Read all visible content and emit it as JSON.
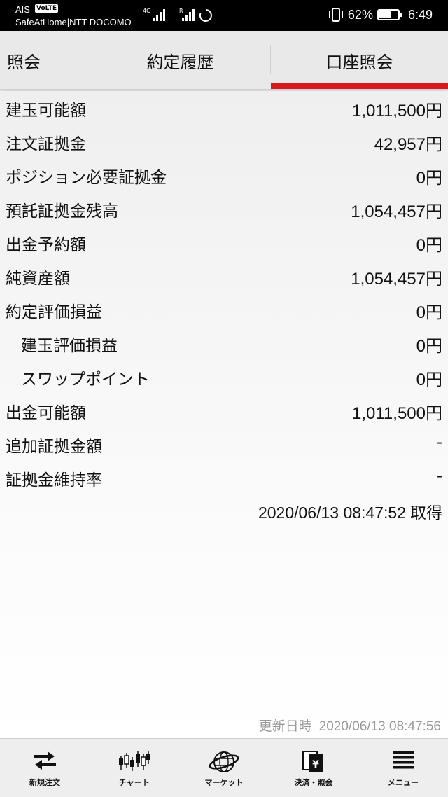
{
  "status_bar": {
    "carrier1": "AIS",
    "volte": "VoLTE",
    "carrier2": "SafeAtHome|NTT DOCOMO",
    "battery_percent": "62%",
    "battery_level": 0.62,
    "time": "6:49"
  },
  "tabs": [
    {
      "label": "照会"
    },
    {
      "label": "約定履歴"
    },
    {
      "label": "口座照会",
      "active": true
    }
  ],
  "accent_color": "#d9191e",
  "rows": [
    {
      "label": "建玉可能額",
      "value": "1,011,500円"
    },
    {
      "label": "注文証拠金",
      "value": "42,957円"
    },
    {
      "label": "ポジション必要証拠金",
      "value": "0円"
    },
    {
      "label": "預託証拠金残高",
      "value": "1,054,457円"
    },
    {
      "label": "出金予約額",
      "value": "0円"
    },
    {
      "label": "純資産額",
      "value": "1,054,457円"
    },
    {
      "label": "約定評価損益",
      "value": "0円"
    },
    {
      "label": "建玉評価損益",
      "value": "0円",
      "indent": true
    },
    {
      "label": "スワップポイント",
      "value": "0円",
      "indent": true
    },
    {
      "label": "出金可能額",
      "value": "1,011,500円"
    },
    {
      "label": "追加証拠金額",
      "value": "-"
    },
    {
      "label": "証拠金維持率",
      "value": "-"
    }
  ],
  "acquired": {
    "datetime": "2020/06/13 08:47:52",
    "suffix": "取得"
  },
  "updated": {
    "label": "更新日時",
    "datetime": "2020/06/13 08:47:56"
  },
  "bottom_nav": [
    {
      "label": "新規注文",
      "icon": "swap-arrows-icon"
    },
    {
      "label": "チャート",
      "icon": "candlestick-chart-icon"
    },
    {
      "label": "マーケット",
      "icon": "globe-icon"
    },
    {
      "label": "決済・照会",
      "icon": "yen-document-icon"
    },
    {
      "label": "メニュー",
      "icon": "hamburger-menu-icon"
    }
  ]
}
